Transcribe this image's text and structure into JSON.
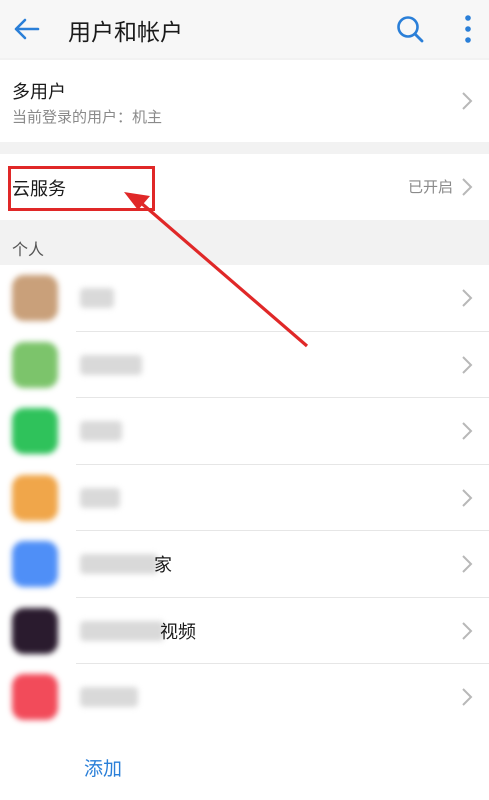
{
  "header": {
    "title": "用户和帐户"
  },
  "multi_user": {
    "title": "多用户",
    "subtitle": "当前登录的用户：机主"
  },
  "cloud_service": {
    "label": "云服务",
    "status": "已开启"
  },
  "personal": {
    "section_title": "个人",
    "accounts": [
      {
        "icon_color": "#c9a07a",
        "name_suffix": ""
      },
      {
        "icon_color": "#7cc46b",
        "name_suffix": ""
      },
      {
        "icon_color": "#2fc25b",
        "name_suffix": ""
      },
      {
        "icon_color": "#f0a64a",
        "name_suffix": ""
      },
      {
        "icon_color": "#4f8ff7",
        "name_suffix": "家"
      },
      {
        "icon_color": "#2a1b2e",
        "name_suffix": "视频"
      },
      {
        "icon_color": "#f24b5a",
        "name_suffix": ""
      }
    ]
  },
  "add_label": "添加",
  "colors": {
    "accent": "#2a7fd8",
    "annotation": "#e02828"
  }
}
